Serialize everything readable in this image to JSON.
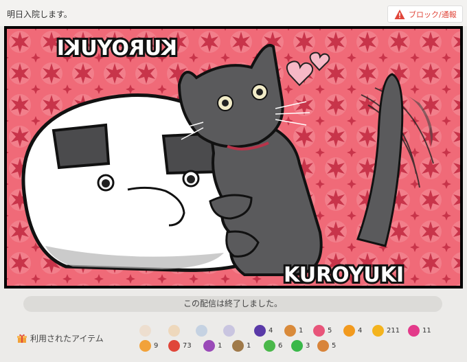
{
  "header": {
    "title": "明日入院します。",
    "report_label": "ブロック/通報"
  },
  "player": {
    "artwork_text_top": "KUROYUKI",
    "artwork_text_bottom": "KUROYUKI"
  },
  "status": {
    "ended_message": "この配信は終了しました。"
  },
  "items_section": {
    "label": "利用されたアイテム",
    "items": [
      {
        "icon": "cake-icon",
        "count": "",
        "color": "#f2c7a0",
        "dim": true
      },
      {
        "icon": "flag-icon",
        "count": "",
        "color": "#f4b46a",
        "dim": true
      },
      {
        "icon": "disc-icon",
        "count": "",
        "color": "#7fa4d8",
        "dim": true
      },
      {
        "icon": "firework-icon",
        "count": "",
        "color": "#8a7fd0",
        "dim": true
      },
      {
        "icon": "purple-firework-icon",
        "count": "4",
        "color": "#5a3aa8",
        "dim": false
      },
      {
        "icon": "bear-icon",
        "count": "1",
        "color": "#d98a3a",
        "dim": false
      },
      {
        "icon": "candy-icon",
        "count": "5",
        "color": "#e8557a",
        "dim": false
      },
      {
        "icon": "orange-icon",
        "count": "4",
        "color": "#f29a1e",
        "dim": false
      },
      {
        "icon": "balloon-icon",
        "count": "211",
        "color": "#f4b41e",
        "dim": false
      },
      {
        "icon": "pink-text-icon",
        "count": "11",
        "color": "#e33a8a",
        "dim": false
      },
      {
        "icon": "ko-icon",
        "count": "9",
        "color": "#f2a23a",
        "dim": false
      },
      {
        "icon": "megaphone-icon",
        "count": "73",
        "color": "#e0463a",
        "dim": false
      },
      {
        "icon": "shoe-icon",
        "count": "1",
        "color": "#9a4ab8",
        "dim": false
      },
      {
        "icon": "stick-icon",
        "count": "1",
        "color": "#a07a4a",
        "dim": false
      },
      {
        "icon": "glowsticks-icon",
        "count": "6",
        "color": "#4ab84a",
        "dim": false
      },
      {
        "icon": "green-text-icon",
        "count": "3",
        "color": "#3ab84a",
        "dim": false
      },
      {
        "icon": "box-icon",
        "count": "5",
        "color": "#d8843a",
        "dim": false
      }
    ]
  }
}
